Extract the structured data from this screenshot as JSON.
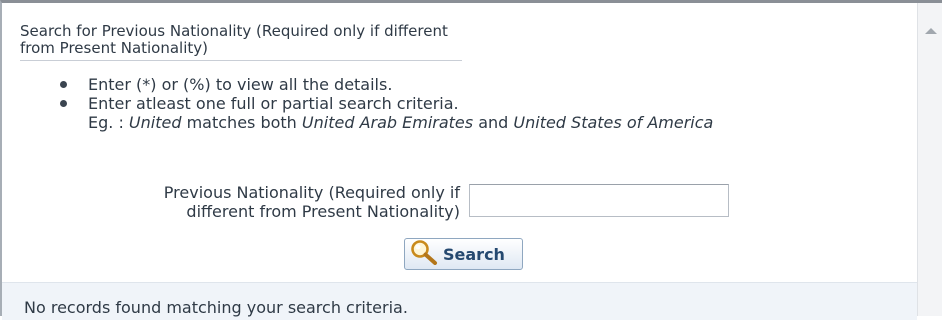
{
  "section": {
    "heading": "Search for Previous Nationality (Required only if different from Present Nationality)"
  },
  "instructions": {
    "bullet_1": "Enter (*) or (%) to view all the details.",
    "bullet_2": "Enter atleast one full or partial search criteria.",
    "example": {
      "prefix": "Eg. : ",
      "term": "United",
      "middle": " matches both ",
      "match_1": "United Arab Emirates",
      "and": " and ",
      "match_2": "United States of America"
    }
  },
  "form": {
    "field_label": "Previous Nationality (Required only if different from Present Nationality)",
    "field_value": ""
  },
  "search_button": {
    "label": "Search",
    "icon": "magnifier-icon"
  },
  "results": {
    "message": "No records found matching your search criteria."
  },
  "scrollbar": {
    "icon": "scroll-up-arrow-icon"
  },
  "colors": {
    "text": "#2f3a46",
    "button_text": "#254970",
    "results_background": "#f0f4f9",
    "window_border": "#8a8f96"
  }
}
